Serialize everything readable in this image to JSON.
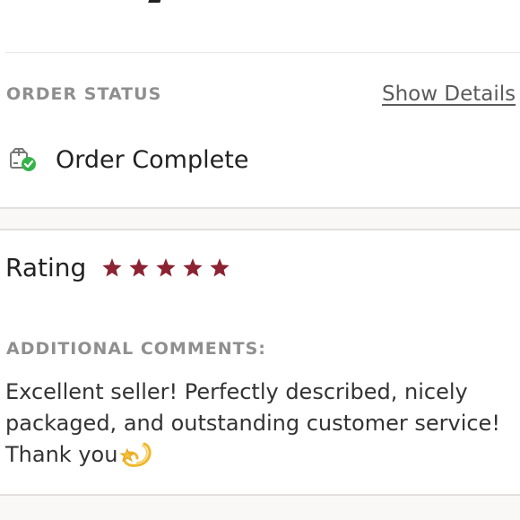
{
  "order_status": {
    "section_label": "ORDER STATUS",
    "show_details_label": "Show Details",
    "status_text": "Order Complete",
    "status_icon": "package-check-icon"
  },
  "rating": {
    "label": "Rating",
    "stars": 5,
    "max_stars": 5,
    "star_color": "#8b2332"
  },
  "comments": {
    "section_label": "ADDITIONAL COMMENTS:",
    "text": "Excellent seller! Perfectly described, nicely packaged, and outstanding customer service! Thank you",
    "emoji": "dizzy-emoji"
  },
  "colors": {
    "check_green": "#35b34a",
    "label_gray": "#8f8f8f",
    "band_bg": "#faf7f7"
  }
}
